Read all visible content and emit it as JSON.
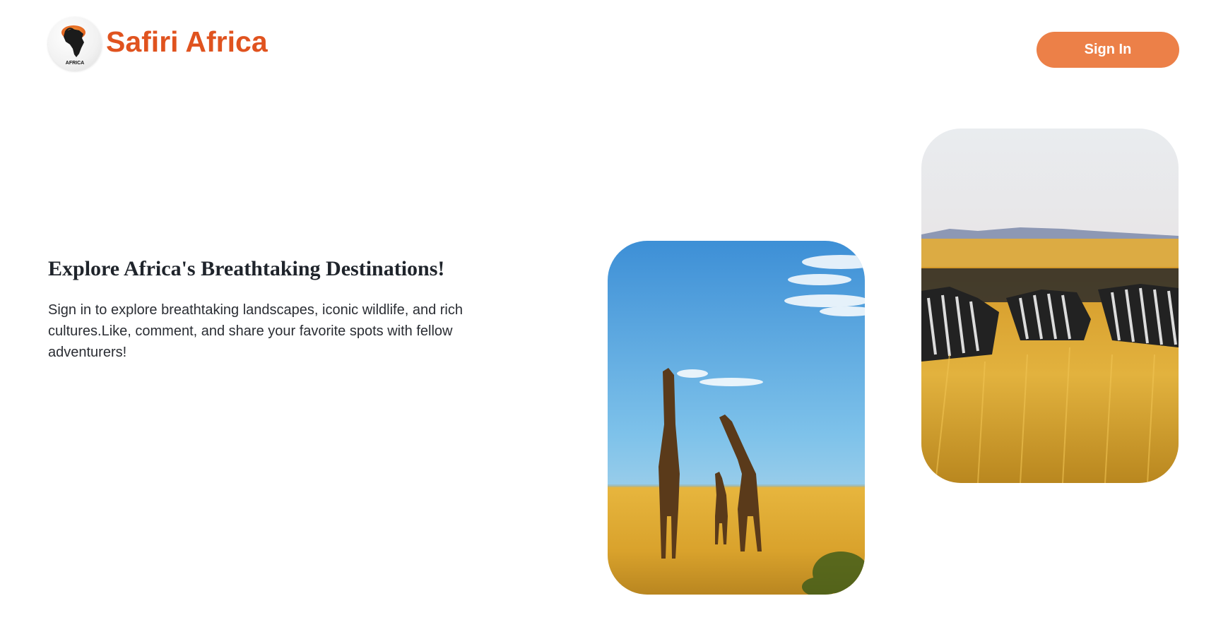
{
  "header": {
    "brand": "Safiri Africa",
    "logo_text": "AFRICA",
    "signin_label": "Sign In"
  },
  "hero": {
    "title": "Explore Africa's Breathtaking Destinations!",
    "description": "Sign in to explore breathtaking landscapes, iconic wildlife, and rich cultures.Like, comment, and share your favorite spots with fellow adventurers!"
  },
  "images": {
    "giraffes": "giraffe-family-photo",
    "zebras": "zebra-herd-photo"
  },
  "colors": {
    "brand": "#e0531f",
    "button": "#ec8048",
    "heading": "#1f242b"
  }
}
